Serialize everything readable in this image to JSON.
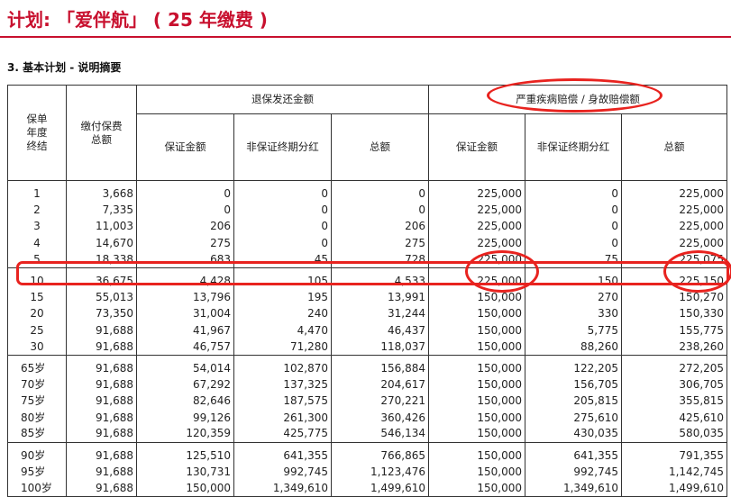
{
  "header": {
    "title": "计划: 「爱伴航」 ( 25 年缴费 )",
    "section": "3.  基本计划 - 说明摘要"
  },
  "colors": {
    "accent": "#c8102e",
    "annotation": "#e8231f"
  },
  "table": {
    "headers": {
      "year_end": "保单年度终结",
      "premium_total": "缴付保费总额",
      "surrender_group": "退保发还金额",
      "critical_group": "严重疾病赔偿 / 身故赔偿额",
      "guaranteed": "保证金额",
      "non_guaranteed_bonus": "非保证终期分红",
      "total": "总额"
    },
    "rows": [
      {
        "year": "1",
        "premium": "3,668",
        "s_guar": "0",
        "s_bonus": "0",
        "s_total": "0",
        "c_guar": "225,000",
        "c_bonus": "0",
        "c_total": "225,000"
      },
      {
        "year": "2",
        "premium": "7,335",
        "s_guar": "0",
        "s_bonus": "0",
        "s_total": "0",
        "c_guar": "225,000",
        "c_bonus": "0",
        "c_total": "225,000"
      },
      {
        "year": "3",
        "premium": "11,003",
        "s_guar": "206",
        "s_bonus": "0",
        "s_total": "206",
        "c_guar": "225,000",
        "c_bonus": "0",
        "c_total": "225,000"
      },
      {
        "year": "4",
        "premium": "14,670",
        "s_guar": "275",
        "s_bonus": "0",
        "s_total": "275",
        "c_guar": "225,000",
        "c_bonus": "0",
        "c_total": "225,000"
      },
      {
        "year": "5",
        "premium": "18,338",
        "s_guar": "683",
        "s_bonus": "45",
        "s_total": "728",
        "c_guar": "225,000",
        "c_bonus": "75",
        "c_total": "225,075"
      },
      {
        "year": "10",
        "premium": "36,675",
        "s_guar": "4,428",
        "s_bonus": "105",
        "s_total": "4,533",
        "c_guar": "225,000",
        "c_bonus": "150",
        "c_total": "225,150"
      },
      {
        "year": "15",
        "premium": "55,013",
        "s_guar": "13,796",
        "s_bonus": "195",
        "s_total": "13,991",
        "c_guar": "150,000",
        "c_bonus": "270",
        "c_total": "150,270"
      },
      {
        "year": "20",
        "premium": "73,350",
        "s_guar": "31,004",
        "s_bonus": "240",
        "s_total": "31,244",
        "c_guar": "150,000",
        "c_bonus": "330",
        "c_total": "150,330"
      },
      {
        "year": "25",
        "premium": "91,688",
        "s_guar": "41,967",
        "s_bonus": "4,470",
        "s_total": "46,437",
        "c_guar": "150,000",
        "c_bonus": "5,775",
        "c_total": "155,775"
      },
      {
        "year": "30",
        "premium": "91,688",
        "s_guar": "46,757",
        "s_bonus": "71,280",
        "s_total": "118,037",
        "c_guar": "150,000",
        "c_bonus": "88,260",
        "c_total": "238,260"
      },
      {
        "year": "65岁",
        "premium": "91,688",
        "s_guar": "54,014",
        "s_bonus": "102,870",
        "s_total": "156,884",
        "c_guar": "150,000",
        "c_bonus": "122,205",
        "c_total": "272,205"
      },
      {
        "year": "70岁",
        "premium": "91,688",
        "s_guar": "67,292",
        "s_bonus": "137,325",
        "s_total": "204,617",
        "c_guar": "150,000",
        "c_bonus": "156,705",
        "c_total": "306,705"
      },
      {
        "year": "75岁",
        "premium": "91,688",
        "s_guar": "82,646",
        "s_bonus": "187,575",
        "s_total": "270,221",
        "c_guar": "150,000",
        "c_bonus": "205,815",
        "c_total": "355,815"
      },
      {
        "year": "80岁",
        "premium": "91,688",
        "s_guar": "99,126",
        "s_bonus": "261,300",
        "s_total": "360,426",
        "c_guar": "150,000",
        "c_bonus": "275,610",
        "c_total": "425,610"
      },
      {
        "year": "85岁",
        "premium": "91,688",
        "s_guar": "120,359",
        "s_bonus": "425,775",
        "s_total": "546,134",
        "c_guar": "150,000",
        "c_bonus": "430,035",
        "c_total": "580,035"
      },
      {
        "year": "90岁",
        "premium": "91,688",
        "s_guar": "125,510",
        "s_bonus": "641,355",
        "s_total": "766,865",
        "c_guar": "150,000",
        "c_bonus": "641,355",
        "c_total": "791,355"
      },
      {
        "year": "95岁",
        "premium": "91,688",
        "s_guar": "130,731",
        "s_bonus": "992,745",
        "s_total": "1,123,476",
        "c_guar": "150,000",
        "c_bonus": "992,745",
        "c_total": "1,142,745"
      },
      {
        "year": "100岁",
        "premium": "91,688",
        "s_guar": "150,000",
        "s_bonus": "1,349,610",
        "s_total": "1,499,610",
        "c_guar": "150,000",
        "c_bonus": "1,349,610",
        "c_total": "1,499,610"
      }
    ]
  }
}
